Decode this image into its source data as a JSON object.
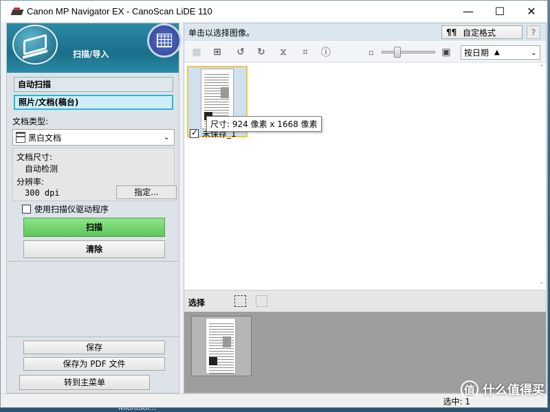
{
  "window": {
    "title": "Canon MP Navigator EX - CanoScan LiDE 110",
    "controls": {
      "minimize": "—",
      "maximize": "☐",
      "close": "✕"
    }
  },
  "left_panel": {
    "header_title": "扫描/导入",
    "modes": {
      "auto_scan": "自动扫描",
      "photo_doc": "照片/文档(稿台)"
    },
    "doc_type_label": "文档类型:",
    "doc_type_value": "黑白文档",
    "doc_size_label": "文档尺寸:",
    "doc_size_value": "自动检测",
    "resolution_label": "分辨率:",
    "resolution_value": "300 dpi",
    "specify_button": "指定...",
    "use_driver_label": "使用扫描仪驱动程序",
    "scan_button": "扫描",
    "clear_button": "清除",
    "save_button": "保存",
    "save_pdf_button": "保存为 PDF 文件",
    "main_menu_button": "转到主菜单"
  },
  "right_panel": {
    "hint": "单击以选择图像。",
    "custom_format_button": "自定格式",
    "help_button": "?",
    "sort_label": "按日期",
    "sort_caret": "▲",
    "thumbnail": {
      "label": "未保存_1",
      "checked": true,
      "tooltip": "尺寸: 924 像素 x 1668 像素"
    },
    "select_label": "选择",
    "status_count": "选中: 1"
  },
  "desktop": {
    "taskbar_text": "Microsof...",
    "watermark": "什么值得买"
  },
  "colors": {
    "accent_teal": "#1a6f8a",
    "scan_green": "#5ec65a",
    "selection_yellow": "#f1c543"
  }
}
